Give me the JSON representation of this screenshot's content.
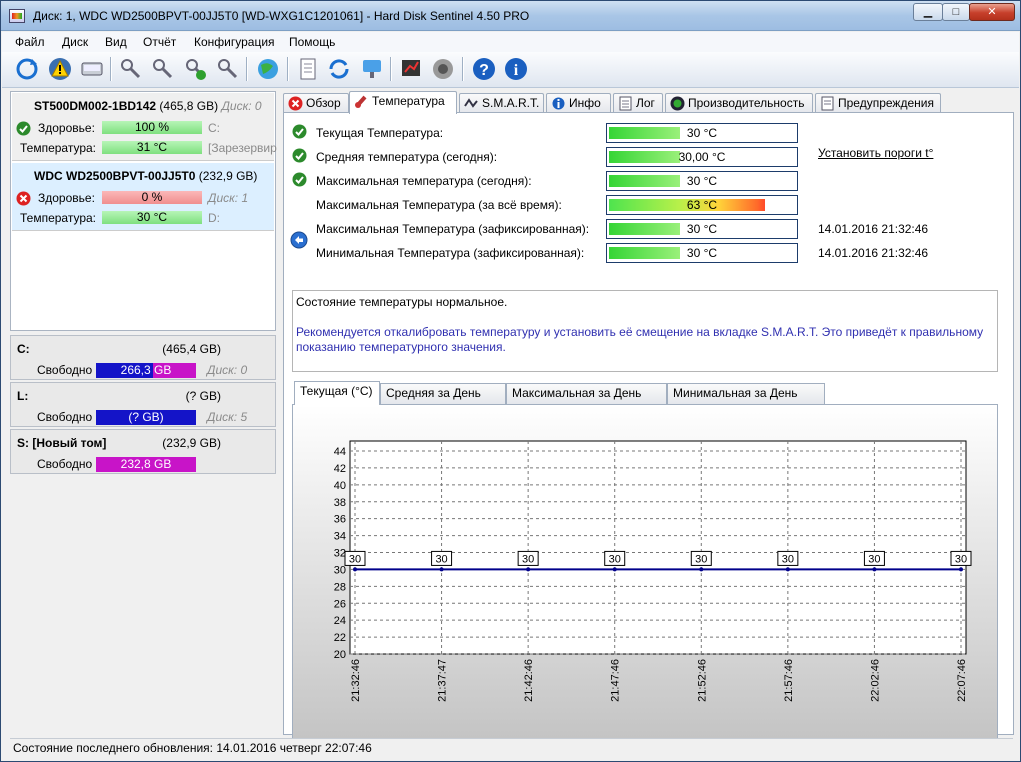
{
  "window": {
    "title": "Диск: 1, WDC WD2500BPVT-00JJ5T0 [WD-WXG1C1201061]  -  Hard Disk Sentinel 4.50 PRO",
    "min_label": "▁",
    "max_label": "□",
    "close_label": "✕"
  },
  "menu": [
    "Файл",
    "Диск",
    "Вид",
    "Отчёт",
    "Конфигурация",
    "Помощь"
  ],
  "toolbar": [
    "refresh-icon",
    "warning-icon",
    "disk-icon",
    "key-icon",
    "key-icon",
    "key-check-icon",
    "key-icon",
    "globe-icon",
    "document-icon",
    "sync-icon",
    "network-icon",
    "report-icon",
    "speaker-icon",
    "help-icon",
    "info-icon"
  ],
  "disks": [
    {
      "name": "ST500DM002-1BD142",
      "size": "(465,8 GB)",
      "disk_no": "Диск: 0",
      "health_label": "Здоровье:",
      "health": "100 %",
      "health_ok": true,
      "health_drive": "C:",
      "temp_label": "Температура:",
      "temp": "31 °C",
      "temp_drive": "[Зарезервир"
    },
    {
      "name": "WDC WD2500BPVT-00JJ5T0",
      "size": "(232,9 GB)",
      "disk_no": "Диск: 1",
      "health_label": "Здоровье:",
      "health": "0 %",
      "health_ok": false,
      "health_drive": "",
      "temp_label": "Температура:",
      "temp": "30 °C",
      "temp_drive": "D:"
    }
  ],
  "volumes": [
    {
      "name": "C:",
      "size": "(465,4 GB)",
      "free_label": "Свободно",
      "free": "266,3 GB",
      "bar_color": "#1414c8",
      "bar_color2": "#c814c8",
      "bar_fraction": 0.57,
      "disk": "Диск: 0"
    },
    {
      "name": "L:",
      "size": "(? GB)",
      "free_label": "Свободно",
      "free": "(? GB)",
      "bar_color": "#1414c8",
      "bar_color2": "#1414c8",
      "bar_fraction": 1.0,
      "disk": "Диск: 5"
    },
    {
      "name": "S: [Новый том]",
      "size": "(232,9 GB)",
      "free_label": "Свободно",
      "free": "232,8 GB",
      "bar_color": "#c814c8",
      "bar_color2": "#c814c8",
      "bar_fraction": 1.0,
      "disk": ""
    }
  ],
  "tabs": [
    {
      "label": "Обзор",
      "icon": "error-icon"
    },
    {
      "label": "Температура",
      "icon": "thermometer-icon"
    },
    {
      "label": "S.M.A.R.T.",
      "icon": "smart-icon"
    },
    {
      "label": "Инфо",
      "icon": "info-icon"
    },
    {
      "label": "Лог",
      "icon": "log-icon"
    },
    {
      "label": "Производительность",
      "icon": "gauge-icon"
    },
    {
      "label": "Предупреждения",
      "icon": "alert-doc-icon"
    }
  ],
  "temps": [
    {
      "label": "Текущая Температура:",
      "value": "30 °C",
      "fill": 0.38,
      "hot": false,
      "check": true,
      "date": ""
    },
    {
      "label": "Средняя температура (сегодня):",
      "value": "30,00 °C",
      "fill": 0.38,
      "hot": false,
      "check": true,
      "date": ""
    },
    {
      "label": "Максимальная температура (сегодня):",
      "value": "30 °C",
      "fill": 0.38,
      "hot": false,
      "check": true,
      "date": ""
    },
    {
      "label": "Максимальная Температура (за всё время):",
      "value": "63 °C",
      "fill": 0.83,
      "hot": true,
      "check": false,
      "date": ""
    },
    {
      "label": "Максимальная Температура (зафиксированная):",
      "value": "30 °C",
      "fill": 0.38,
      "hot": false,
      "check": false,
      "date": "14.01.2016 21:32:46"
    },
    {
      "label": "Минимальная Температура (зафиксированная):",
      "value": "30 °C",
      "fill": 0.38,
      "hot": false,
      "check": false,
      "date": "14.01.2016 21:32:46"
    }
  ],
  "threshold_link": "Установить пороги t°",
  "message": {
    "status": "Состояние температуры нормальное.",
    "advice": "Рекомендуется откалибровать температуру и установить её смещение на вкладке S.M.A.R.T. Это приведёт к правильному показанию температурного значения."
  },
  "graph_tabs": [
    "Текущая (°C)",
    "Средняя за День (°C)",
    "Максимальная за День (°C)",
    "Минимальная за День (°C)"
  ],
  "chart_data": {
    "type": "line",
    "x": [
      "21:32:46",
      "21:37:47",
      "21:42:46",
      "21:47:46",
      "21:52:46",
      "21:57:46",
      "22:02:46",
      "22:07:46"
    ],
    "series": [
      {
        "values": [
          30,
          30,
          30,
          30,
          30,
          30,
          30,
          30
        ]
      }
    ],
    "ylim": [
      20,
      44
    ],
    "yticks": [
      20,
      22,
      24,
      26,
      28,
      30,
      32,
      34,
      36,
      38,
      40,
      42,
      44
    ],
    "grid": true,
    "line_color": "#00008b"
  },
  "status": "Состояние последнего обновления: 14.01.2016 четверг 22:07:46"
}
